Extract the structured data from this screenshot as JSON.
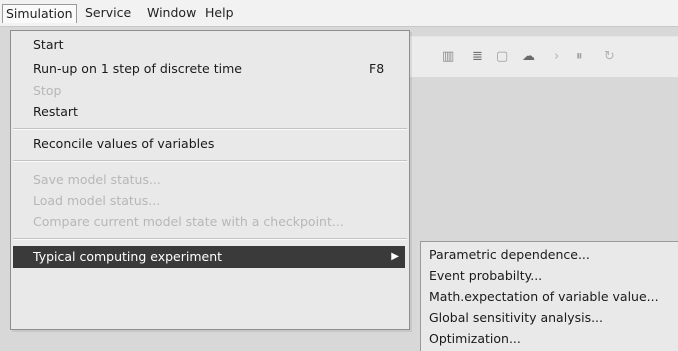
{
  "menubar": {
    "items": [
      "Simulation",
      "Service",
      "Window",
      "Help"
    ]
  },
  "toolbar": {
    "icons": [
      "tool-a-icon",
      "tool-b-icon",
      "tool-c-icon",
      "tool-d-icon",
      "tool-e-icon",
      "tool-f-icon",
      "tool-g-icon"
    ]
  },
  "simulation_menu": {
    "start": "Start",
    "runup": "Run-up on 1 step of discrete time",
    "runup_shortcut": "F8",
    "stop": "Stop",
    "restart": "Restart",
    "reconcile": "Reconcile values of variables",
    "save_status": "Save model status...",
    "load_status": "Load model status...",
    "compare": "Compare current model state with a checkpoint...",
    "typical": "Typical computing experiment"
  },
  "submenu": {
    "items": [
      "Parametric dependence...",
      "Event probabilty...",
      "Math.expectation of variable value...",
      "Global sensitivity analysis...",
      "Optimization..."
    ]
  },
  "colors": {
    "highlight": "#3a3a3a",
    "menu_bg": "#e9e9e9",
    "disabled_text": "#b7b7b7"
  }
}
